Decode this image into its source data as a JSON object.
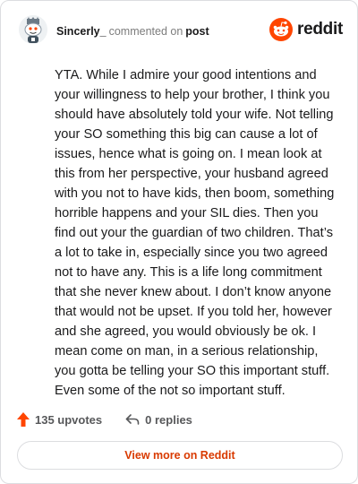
{
  "header": {
    "username": "Sincerly_",
    "action": "commented on",
    "target": "post",
    "logo_text": "reddit"
  },
  "comment": {
    "text": "YTA. While I admire your good intentions and your willingness to help your brother, I think you should have absolutely told your wife. Not telling your SO something this big can cause a lot of issues, hence what is going on. I mean look at this from her perspective, your husband agreed with you not to have kids, then boom, something horrible happens and your SIL dies. Then you find out your the guardian of two children. That’s a lot to take in, especially since you two agreed not to have any. This is a life long commitment that she never knew about. I don’t know anyone that would not be upset. If you told her, however and she agreed, you would obviously be ok. I mean come on man, in a serious relationship, you gotta be telling your SO this important stuff. Even some of the not so important stuff."
  },
  "footer": {
    "upvotes": "135 upvotes",
    "replies": "0 replies",
    "view_more": "View more on Reddit"
  },
  "colors": {
    "brand": "#ff4500",
    "link": "#d93a00",
    "muted": "#7c7c7c"
  },
  "icons": {
    "avatar": "snoo-avatar",
    "logo": "reddit-logo-icon",
    "upvote": "upvote-arrow-icon",
    "reply": "reply-arrow-icon"
  }
}
